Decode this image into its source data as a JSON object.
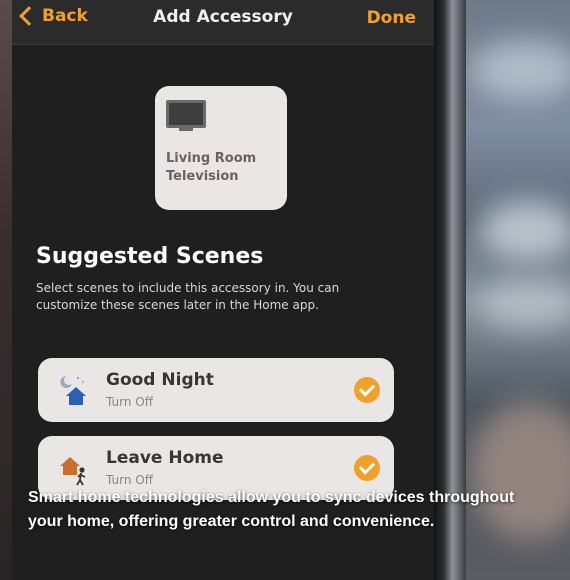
{
  "nav": {
    "back_label": "Back",
    "title": "Add Accessory",
    "done_label": "Done"
  },
  "accessory": {
    "name": "Living Room Television",
    "icon": "tv-icon"
  },
  "scenes_section": {
    "title": "Suggested Scenes",
    "description": "Select scenes to include this accessory in. You can customize these scenes later in the Home app."
  },
  "scenes": [
    {
      "name": "Good Night",
      "subtitle": "Turn Off",
      "icon": "moon-house-icon",
      "selected": true
    },
    {
      "name": "Leave Home",
      "subtitle": "Turn Off",
      "icon": "walking-person-house-icon",
      "selected": true
    }
  ],
  "caption": "Smart home technologies allow you to sync devices throughout your home, offering greater control and convenience.",
  "colors": {
    "accent": "#f0a12b",
    "tile_bg": "#ebe6e6",
    "screen_bg": "#1f1f1f"
  }
}
